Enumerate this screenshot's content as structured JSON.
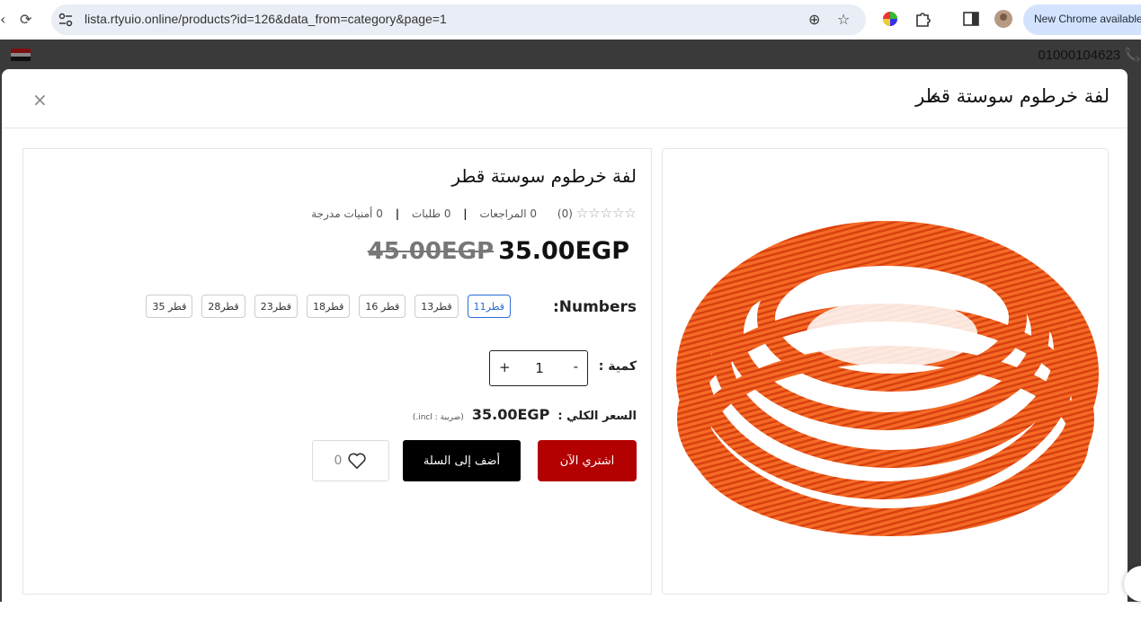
{
  "browser": {
    "url": "lista.rtyuio.online/products?id=126&data_from=category&page=1",
    "new_chrome_label": "New Chrome available"
  },
  "site": {
    "phone": "01000104623"
  },
  "modal": {
    "header_title": "لفة خرطوم سوستة قطر",
    "close_label": "×"
  },
  "product": {
    "title": "لفة خرطوم سوستة قطر",
    "rating_count": "(0)",
    "reviews": "0 المراجعات",
    "orders": "0 طلبات",
    "wishlist_count_label": "0 أمنيات مدرجة",
    "old_price": "45.00EGP",
    "price": "35.00EGP",
    "variant_label": ":Numbers",
    "variants": [
      "11قطر",
      "13قطر",
      "16 قطر",
      "18قطر",
      "23قطر",
      "28قطر",
      "35 قطر"
    ],
    "selected_variant": 0,
    "qty_label": "كمية :",
    "qty": "1",
    "qty_minus": "-",
    "qty_plus": "+",
    "total_label": "السعر الكلي :",
    "total_value": "35.00EGP",
    "tax_note": "(ضريبة : incl.)",
    "buy_now": "اشتري الآن",
    "add_to_cart": "أضف إلى السلة",
    "wish_count": "0"
  },
  "colors": {
    "buy_button": "#b30000",
    "cart_button": "#000000",
    "selected_variant": "#2b6cd6",
    "hose": "#f25a1c"
  }
}
